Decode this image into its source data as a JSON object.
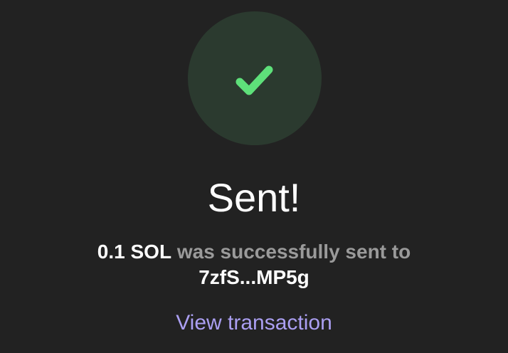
{
  "status": {
    "icon": "checkmark-icon",
    "circle_color": "#2b3a2f",
    "check_color": "#5ee07a"
  },
  "title": "Sent!",
  "message": {
    "amount": "0.1 SOL",
    "text": "was successfully sent to",
    "recipient": "7zfS...MP5g"
  },
  "link": {
    "label": "View transaction",
    "color": "#ab9ff2"
  }
}
